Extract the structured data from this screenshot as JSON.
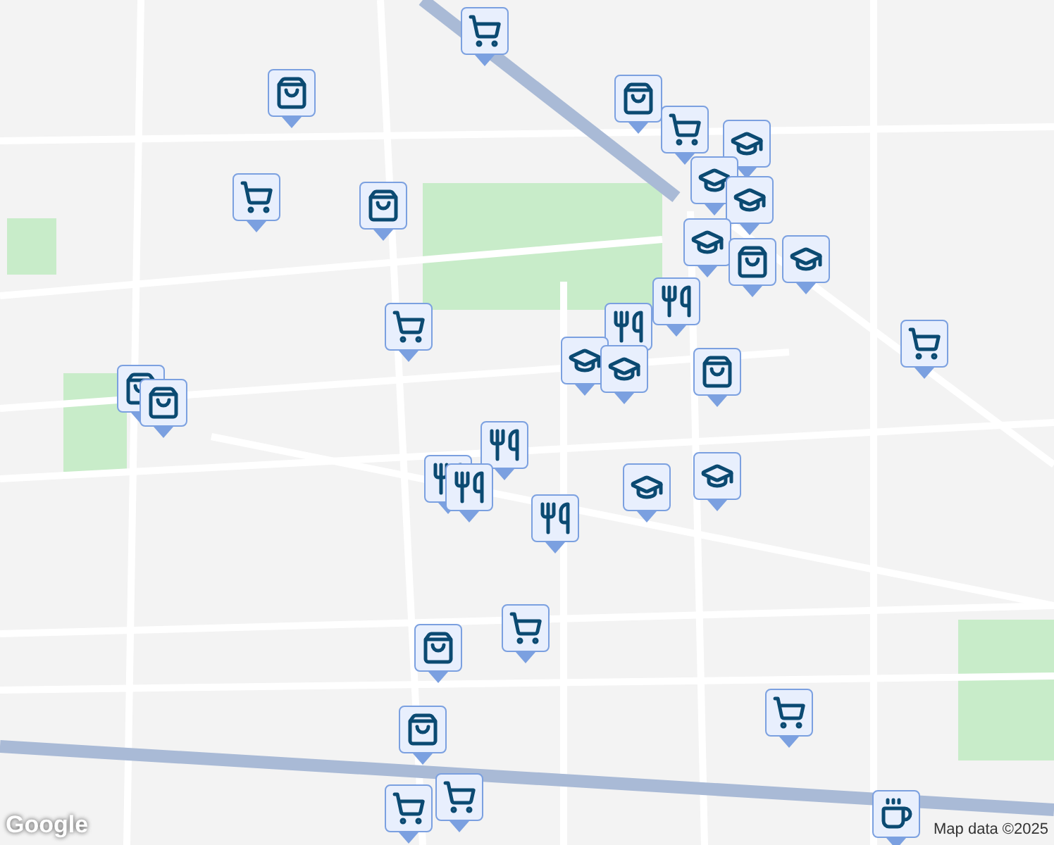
{
  "map": {
    "markers": [
      {
        "kind": "cart"
      },
      {
        "kind": "bag"
      },
      {
        "kind": "bag"
      },
      {
        "kind": "cart"
      },
      {
        "kind": "school"
      },
      {
        "kind": "school"
      },
      {
        "kind": "school"
      },
      {
        "kind": "cart"
      },
      {
        "kind": "bag"
      },
      {
        "kind": "school"
      },
      {
        "kind": "bag"
      },
      {
        "kind": "school"
      },
      {
        "kind": "food"
      },
      {
        "kind": "food"
      },
      {
        "kind": "cart"
      },
      {
        "kind": "school"
      },
      {
        "kind": "school"
      },
      {
        "kind": "bag"
      },
      {
        "kind": "cart"
      },
      {
        "kind": "bag"
      },
      {
        "kind": "bag"
      },
      {
        "kind": "food"
      },
      {
        "kind": "food"
      },
      {
        "kind": "food"
      },
      {
        "kind": "school"
      },
      {
        "kind": "school"
      },
      {
        "kind": "food"
      },
      {
        "kind": "cart"
      },
      {
        "kind": "bag"
      },
      {
        "kind": "bag"
      },
      {
        "kind": "cart"
      },
      {
        "kind": "cart"
      },
      {
        "kind": "cart"
      },
      {
        "kind": "cafe"
      }
    ],
    "logo": "Google",
    "attribution": "Map data ©2025"
  }
}
